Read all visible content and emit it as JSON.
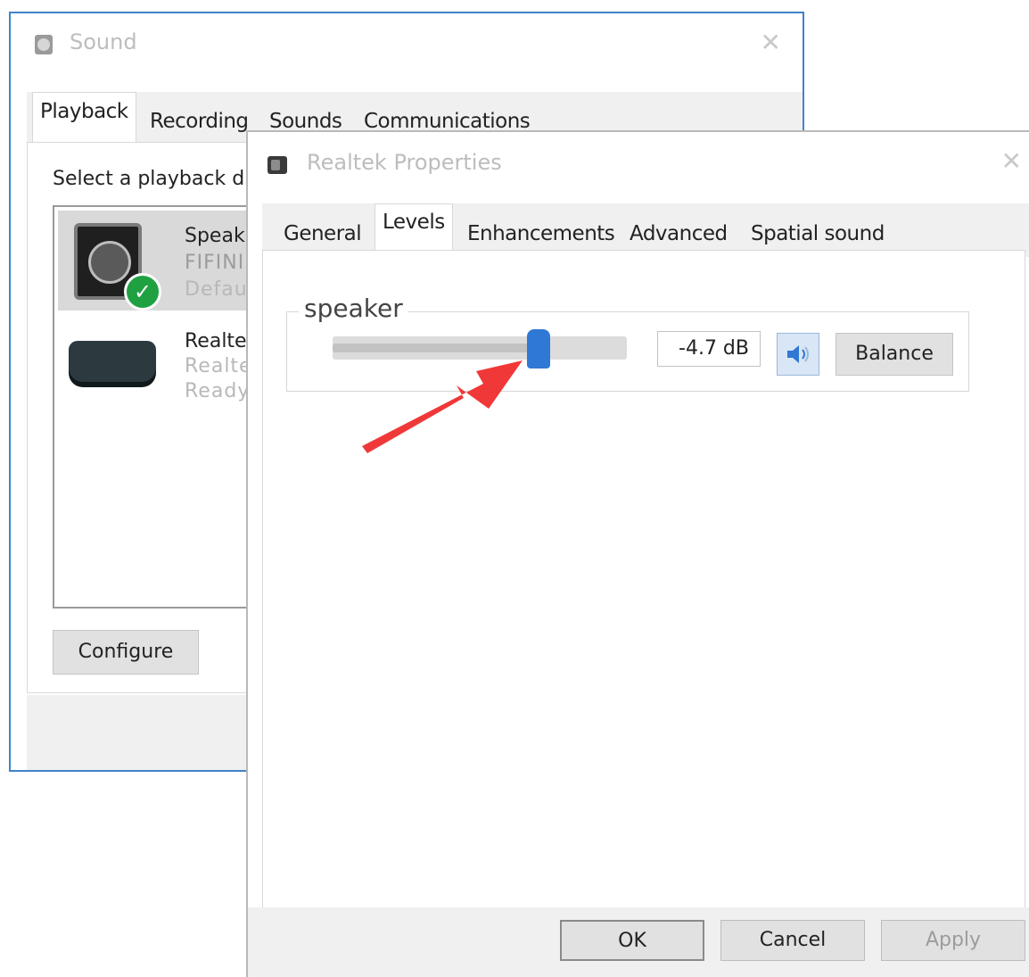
{
  "sound_dialog": {
    "title": "Sound",
    "tabs": [
      "Playback",
      "Recording",
      "Sounds",
      "Communications"
    ],
    "instruction": "Select a playback d",
    "devices": [
      {
        "name": "Speak",
        "detail": "FIFINI",
        "status": "Defaul",
        "default": true
      },
      {
        "name": "Realte",
        "detail": "Realte",
        "status": "Ready",
        "default": false
      }
    ],
    "configure_label": "Configure"
  },
  "props_dialog": {
    "title": "Realtek Properties",
    "tabs": [
      "General",
      "Levels",
      "Enhancements",
      "Advanced",
      "Spatial sound"
    ],
    "selected_tab": "Levels",
    "group_label": "speaker",
    "slider_level": 0.7,
    "level_value": "-4.7 dB",
    "balance_label": "Balance",
    "buttons": {
      "ok": "OK",
      "cancel": "Cancel",
      "apply": "Apply"
    }
  },
  "colors": {
    "accent": "#2f78d4",
    "window_border": "#3f83c9",
    "default_badge": "#1fa142",
    "annotation_arrow": "#f03838"
  },
  "icons": [
    "speaker-app-icon",
    "close-icon",
    "speaker-device-icon",
    "check-icon",
    "sound-box-icon",
    "volume-mute-icon",
    "red-arrow-annotation"
  ]
}
